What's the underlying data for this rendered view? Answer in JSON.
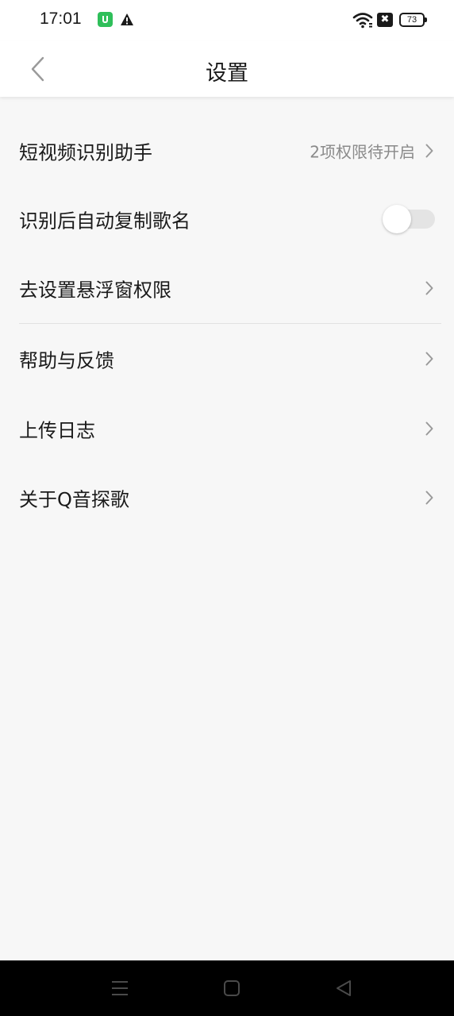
{
  "status_bar": {
    "time": "17:01",
    "battery_level": "73",
    "sim_badge": "✖",
    "icons": [
      "app-notification-icon",
      "warning-icon",
      "wifi-icon",
      "sim-icon",
      "battery-icon"
    ]
  },
  "header": {
    "title": "设置",
    "back_icon": "chevron-left-icon"
  },
  "settings": {
    "items": [
      {
        "label": "短视频识别助手",
        "value": "2项权限待开启",
        "control": "chevron"
      },
      {
        "label": "识别后自动复制歌名",
        "control": "toggle",
        "toggle_on": false
      },
      {
        "label": "去设置悬浮窗权限",
        "control": "chevron"
      },
      {
        "label": "帮助与反馈",
        "control": "chevron"
      },
      {
        "label": "上传日志",
        "control": "chevron"
      },
      {
        "label": "关于Q音探歌",
        "control": "chevron"
      }
    ]
  },
  "nav_bar": {
    "buttons": [
      "menu-icon",
      "home-icon",
      "back-triangle-icon"
    ]
  },
  "colors": {
    "background": "#f7f7f7",
    "header_bg": "#ffffff",
    "text_primary": "#1a1a1a",
    "text_secondary": "#8a8a8a",
    "toggle_off_track": "#e4e4e4",
    "nav_bar_bg": "#000000"
  }
}
